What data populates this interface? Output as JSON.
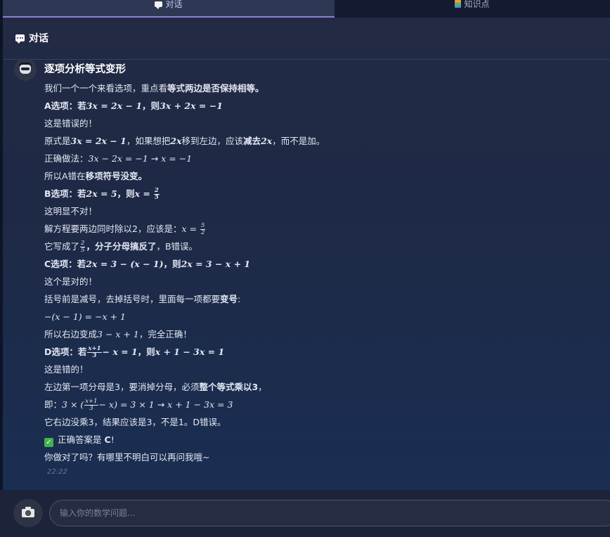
{
  "tabs": [
    {
      "label": "对话",
      "icon": "chat-bubble-icon",
      "active": true
    },
    {
      "label": "知识点",
      "icon": "books-icon",
      "active": false
    }
  ],
  "header": {
    "title": "对话",
    "icon": "chat-bubble-icon"
  },
  "message": {
    "avatar": "bear-avatar",
    "title": "逐项分析等式变形",
    "intro": {
      "plain": "我们一个一个来看选项，重点看",
      "bold": "等式两边是否保持相等。"
    },
    "a_label": "A选项：若",
    "a_eq1": "3x = 2x − 1",
    "a_then": "，则",
    "a_eq2": "3x + 2x = −1",
    "a_verdict": "这是错误的！",
    "a_expl": {
      "p1": "原式是",
      "m1": "3x = 2x − 1",
      "p2": "，如果想把",
      "m2": "2x",
      "p3": "移到左边，应该",
      "b1": "减去",
      "m3": "2x",
      "p4": "，而不是加。"
    },
    "a_correct": {
      "p1": "正确做法：",
      "m1": "3x − 2x = −1",
      "arrow": "→",
      "m2": "x = −1"
    },
    "a_reason": {
      "p1": "所以A错在",
      "b1": "移项符号没变。"
    },
    "b_label": "B选项：若",
    "b_eq1": "2x = 5",
    "b_then": "，则",
    "b_lhs": "x =",
    "b_num": "2",
    "b_den": "5",
    "b_verdict": "这明显不对！",
    "b_expl": {
      "p1": "解方程要两边同时除以2，应该是：",
      "lhs": "x =",
      "num": "5",
      "den": "2"
    },
    "b_wrong": {
      "p1": "它写成了",
      "num": "2",
      "den": "5",
      "b1": "，分子分母搞反了",
      "p2": "，B错误。"
    },
    "c_label": "C选项：若",
    "c_eq1": "2x = 3 − (x − 1)",
    "c_then": "，则",
    "c_eq2": "2x = 3 − x + 1",
    "c_verdict": "这个是对的！",
    "c_expl": {
      "p1": "括号前是减号，去掉括号时，里面每一项都要",
      "b1": "变号",
      "p2": ":"
    },
    "c_formula": "−(x − 1) = −x + 1",
    "c_concl": {
      "p1": "所以右边变成",
      "m1": "3 − x + 1",
      "p2": "，完全正确！"
    },
    "d_label": "D选项：若",
    "d_num": "x+1",
    "d_den": "3",
    "d_eq1_rest": "− x = 1",
    "d_then": "，则",
    "d_eq2": "x + 1 − 3x = 1",
    "d_verdict": "这是错的！",
    "d_expl": {
      "p1": "左边第一项分母是3，要消掉分母，必须",
      "b1": "整个等式乘以3",
      "p2": "，"
    },
    "d_calc": {
      "p1": "即：",
      "m1": "3 × (",
      "num": "x+1",
      "den": "3",
      "m2": "− x) = 3 × 1",
      "arrow": "→",
      "m3": "x + 1 − 3x = 3"
    },
    "d_concl": "它右边没乘3，结果应该是3，不是1。D错误。",
    "answer": {
      "check": "✓",
      "p1": "正确答案是",
      "b1": "C",
      "p2": "!"
    },
    "closing": "你做对了吗？有哪里不明白可以再问我哦~",
    "timestamp": "22:22"
  },
  "input": {
    "placeholder": "输入你的数学问题...",
    "value": ""
  },
  "camera": {
    "icon": "camera-icon"
  }
}
